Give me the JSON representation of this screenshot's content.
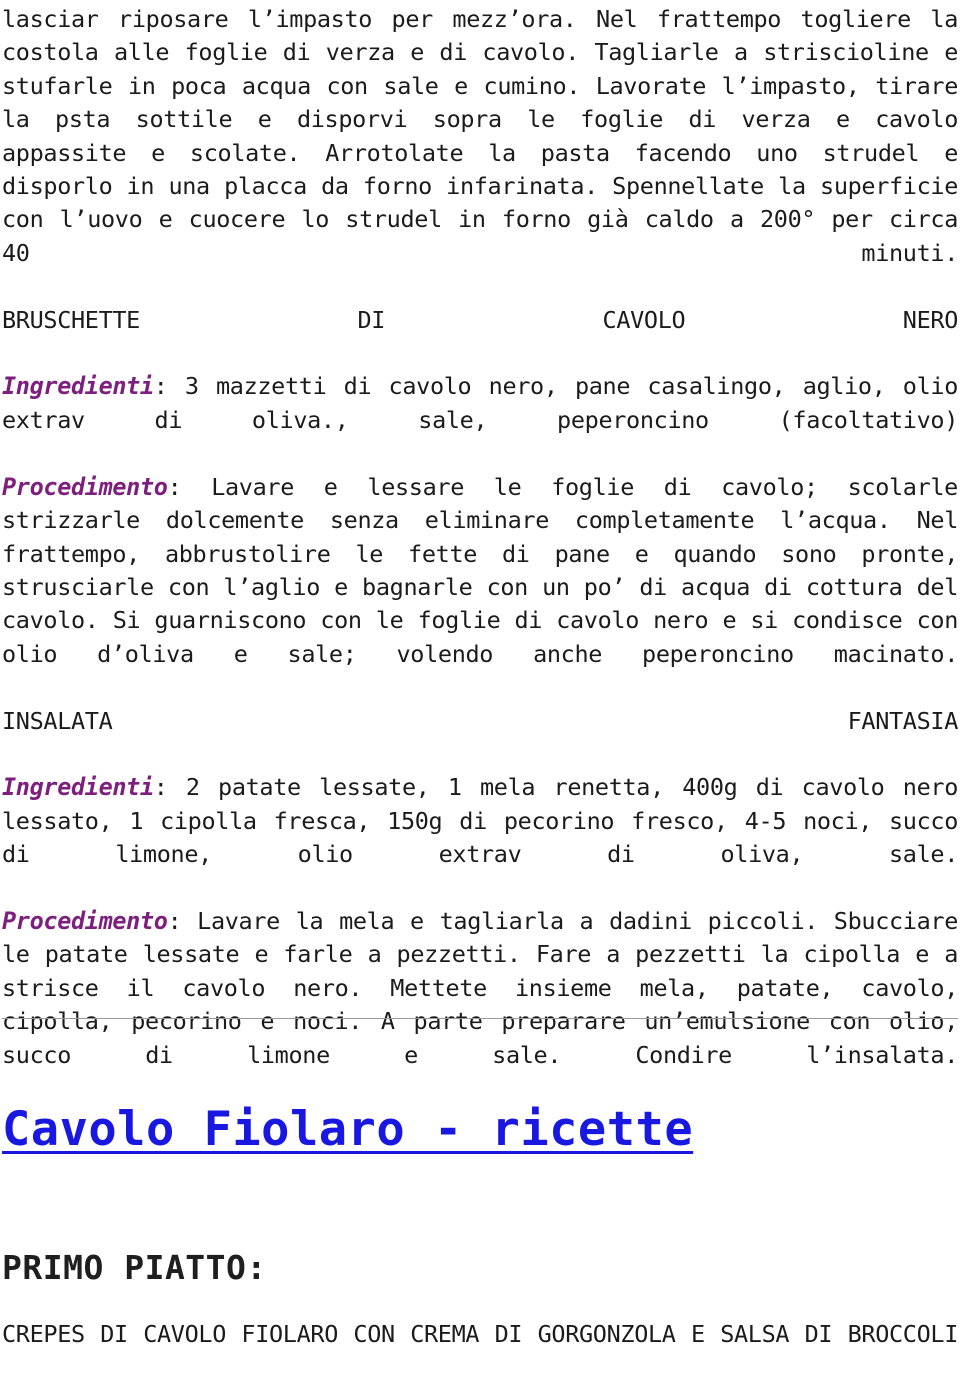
{
  "document": {
    "page_kind": "recipe-page",
    "background_color": "#ffffff",
    "body_text_color": "#1b1b1b",
    "label_color": "#7d1f7d",
    "link_color": "#1818e0",
    "divider_color": "#9a9a9a"
  },
  "body": {
    "paragraph_1": "lasciar riposare l’impasto per mezz’ora. Nel frattempo togliere la costola alle foglie di verza e di cavolo. Tagliarle a striscioline e stufarle in poca acqua con sale e cumino. Lavorate l’impasto, tirare la psta sottile e disporvi sopra le foglie di verza e cavolo appassite e scolate. Arrotolate la pasta facendo uno strudel e disporlo in una placca da forno infarinata. Spennellate la superficie con l’uovo e cuocere lo strudel in forno già caldo a 200° per circa 40 minuti.",
    "recipe_1": {
      "title": "BRUSCHETTE DI CAVOLO NERO",
      "ingredienti_label": "Ingredienti",
      "ingredienti_text": ": 3 mazzetti di cavolo nero, pane casalingo, aglio, olio extrav di oliva., sale, peperoncino (facoltativo)",
      "procedimento_label": "Procedimento",
      "procedimento_text": ": Lavare e lessare le foglie di cavolo; scolarle strizzarle dolcemente senza eliminare completamente l’acqua. Nel frattempo, abbrustolire le fette di pane e quando sono pronte, strusciarle con l’aglio e bagnarle con un po’ di acqua di cottura del cavolo. Si guarniscono con le foglie di cavolo nero e si condisce con olio d’oliva e sale; volendo anche peperoncino macinato."
    },
    "recipe_2": {
      "title": "INSALATA FANTASIA",
      "ingredienti_label": "Ingredienti",
      "ingredienti_text": ": 2 patate lessate, 1 mela renetta, 400g di cavolo nero lessato, 1 cipolla fresca, 150g di pecorino fresco, 4-5 noci, succo di limone, olio extrav di oliva, sale.",
      "procedimento_label": "Procedimento",
      "procedimento_text": ": Lavare la mela e tagliarla a dadini piccoli. Sbucciare le patate lessate e farle a pezzetti. Fare a pezzetti la cipolla e a strisce il cavolo nero. Mettete insieme mela, patate, cavolo, cipolla, pecorino e noci. A parte preparare un’emulsione con olio, succo di limone e sale. Condire l’insalata."
    }
  },
  "next_section": {
    "link_title": "Cavolo Fiolaro - ricette",
    "section_heading": "PRIMO PIATTO:",
    "first_recipe_name": "CREPES DI CAVOLO FIOLARO CON CREMA DI GORGONZOLA E SALSA DI BROCCOLI"
  }
}
